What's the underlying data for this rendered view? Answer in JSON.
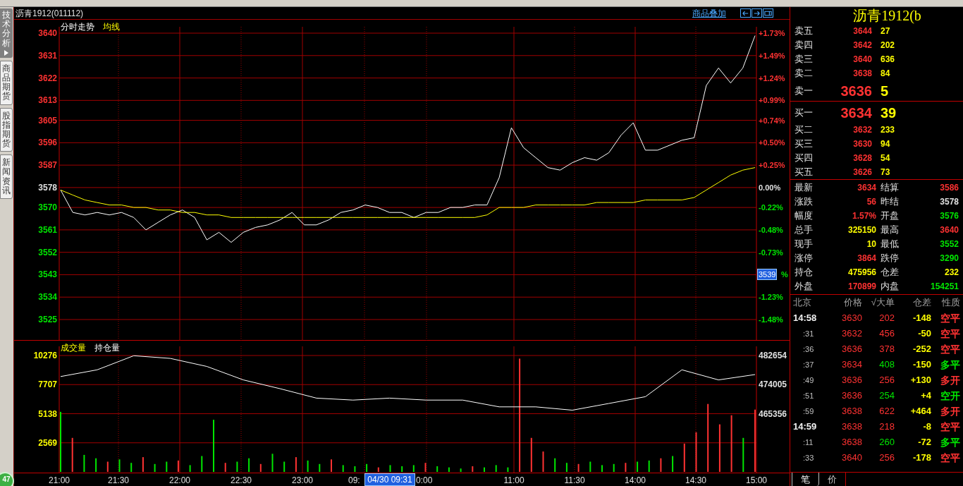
{
  "side_tabs": [
    {
      "label": "技术分析",
      "selected": true
    },
    {
      "label": "商品期货",
      "selected": false
    },
    {
      "label": "股指期货",
      "selected": false
    },
    {
      "label": "新闻资讯",
      "selected": false
    }
  ],
  "badge": "47",
  "chart_header": {
    "title": "沥青1912(011112)",
    "overlay_link": "商品叠加"
  },
  "price_pane": {
    "percent_labels": [
      {
        "text": "+1.73%",
        "color": "#ff3232"
      },
      {
        "text": "+1.49%",
        "color": "#ff3232"
      },
      {
        "text": "+1.24%",
        "color": "#ff3232"
      },
      {
        "text": "+0.99%",
        "color": "#ff3232"
      },
      {
        "text": "+0.74%",
        "color": "#ff3232"
      },
      {
        "text": "+0.50%",
        "color": "#ff3232"
      },
      {
        "text": "+0.25%",
        "color": "#ff3232"
      },
      {
        "text": "0.00%",
        "color": "#e0e0e0"
      },
      {
        "text": "-0.22%",
        "color": "#00e600"
      },
      {
        "text": "-0.48%",
        "color": "#00e600"
      },
      {
        "text": "-0.73%",
        "color": "#00e600"
      },
      {
        "text": "%",
        "color": "#00e600"
      },
      {
        "text": "-1.23%",
        "color": "#00e600"
      },
      {
        "text": "-1.48%",
        "color": "#00e600"
      }
    ],
    "chart_data": {
      "type": "line",
      "ylim": [
        3525,
        3640
      ],
      "grid": true,
      "yticks": [
        {
          "value": 3640,
          "label": "3640"
        },
        {
          "value": 3631,
          "label": "3631"
        },
        {
          "value": 3622,
          "label": "3622"
        },
        {
          "value": 3613,
          "label": "3613"
        },
        {
          "value": 3605,
          "label": "3605"
        },
        {
          "value": 3596,
          "label": "3596"
        },
        {
          "value": 3587,
          "label": "3587"
        },
        {
          "value": 3578,
          "label": "3578"
        },
        {
          "value": 3570,
          "label": "3570"
        },
        {
          "value": 3561,
          "label": "3561"
        },
        {
          "value": 3552,
          "label": "3552"
        },
        {
          "value": 3543,
          "label": "3543"
        },
        {
          "value": 3534,
          "label": "3534"
        },
        {
          "value": 3525,
          "label": "3525"
        }
      ],
      "series": [
        {
          "name": "分时走势",
          "color": "#ffffff",
          "values": [
            3577,
            3568,
            3567,
            3568,
            3567,
            3568,
            3566,
            3561,
            3564,
            3567,
            3569,
            3566,
            3557,
            3560,
            3556,
            3560,
            3562,
            3563,
            3565,
            3568,
            3563,
            3563,
            3565,
            3568,
            3569,
            3571,
            3570,
            3568,
            3568,
            3566,
            3568,
            3568,
            3570,
            3570,
            3571,
            3571,
            3582,
            3602,
            3594,
            3590,
            3586,
            3585,
            3588,
            3590,
            3589,
            3592,
            3599,
            3604,
            3593,
            3593,
            3595,
            3597,
            3598,
            3619,
            3626,
            3620,
            3626,
            3639
          ]
        },
        {
          "name": "均线",
          "color": "#ffff00",
          "values": [
            3577,
            3575,
            3573,
            3572,
            3571,
            3571,
            3570,
            3570,
            3569,
            3569,
            3568,
            3568,
            3567,
            3567,
            3566,
            3566,
            3566,
            3566,
            3566,
            3566,
            3566,
            3566,
            3566,
            3566,
            3566,
            3566,
            3566,
            3566,
            3566,
            3566,
            3566,
            3566,
            3566,
            3566,
            3566,
            3567,
            3570,
            3570,
            3570,
            3571,
            3571,
            3571,
            3571,
            3571,
            3572,
            3572,
            3572,
            3572,
            3573,
            3573,
            3573,
            3573,
            3574,
            3577,
            3580,
            3583,
            3585,
            3586
          ]
        }
      ]
    }
  },
  "volume_pane": {
    "volume": {
      "chart_data": {
        "type": "bar",
        "ylim": [
          0,
          10276
        ],
        "grid": true,
        "yticks": [
          {
            "value": 10276,
            "label": "10276"
          },
          {
            "value": 7707,
            "label": "7707"
          },
          {
            "value": 5138,
            "label": "5138"
          },
          {
            "value": 2569,
            "label": "2569"
          }
        ],
        "series": [
          {
            "name": "成交量",
            "color": "#ff3232",
            "values": [
              null,
              3000,
              null,
              null,
              900,
              null,
              null,
              1300,
              null,
              null,
              1000,
              null,
              null,
              null,
              800,
              null,
              null,
              700,
              null,
              null,
              1300,
              null,
              null,
              1100,
              null,
              null,
              null,
              400,
              null,
              null,
              null,
              800,
              null,
              null,
              null,
              500,
              null,
              null,
              null,
              10000,
              3000,
              1800,
              null,
              null,
              700,
              null,
              null,
              null,
              800,
              null,
              null,
              1200,
              null,
              2500,
              3500,
              6000,
              4200,
              5000,
              null,
              5500
            ]
          },
          {
            "color": "#00e600",
            "values": [
              5300,
              null,
              1500,
              1200,
              null,
              1100,
              800,
              null,
              700,
              900,
              null,
              600,
              1400,
              4600,
              null,
              900,
              1200,
              null,
              1600,
              900,
              null,
              1000,
              700,
              null,
              600,
              500,
              700,
              null,
              600,
              500,
              600,
              null,
              500,
              400,
              300,
              null,
              400,
              600,
              400,
              null,
              null,
              null,
              1200,
              800,
              null,
              900,
              600,
              700,
              null,
              900,
              1000,
              null,
              1400,
              null,
              null,
              null,
              null,
              null,
              3000,
              null
            ]
          }
        ]
      }
    },
    "open_interest": {
      "chart_data": {
        "type": "line",
        "ylim": [
          465356,
          482654
        ],
        "yticks": [
          {
            "value": 482654,
            "label": "482654"
          },
          {
            "value": 474005,
            "label": "474005"
          },
          {
            "value": 465356,
            "label": "465356"
          }
        ],
        "series": [
          {
            "name": "持仓量",
            "color": "#ffffff",
            "values": [
              476400,
              478400,
              482600,
              481800,
              479400,
              475400,
              472800,
              470000,
              469400,
              470000,
              469400,
              469400,
              467400,
              467400,
              466400,
              468400,
              470400,
              478400,
              475400,
              477000
            ]
          }
        ]
      }
    }
  },
  "time_axis": {
    "labels": [
      "21:00",
      "21:30",
      "22:00",
      "22:30",
      "23:00",
      "09:",
      "0:00",
      "11:00",
      "11:30",
      "14:00",
      "14:30",
      "15:00"
    ]
  },
  "crosshair": {
    "price_label": "3539",
    "time_label": "04/30 09:31"
  },
  "quote": {
    "title": "沥青1912(b",
    "asks": [
      {
        "label": "卖五",
        "price": "3644",
        "volume": "27",
        "kind": "level"
      },
      {
        "label": "卖四",
        "price": "3642",
        "volume": "202",
        "kind": "level"
      },
      {
        "label": "卖三",
        "price": "3640",
        "volume": "636",
        "kind": "level"
      },
      {
        "label": "卖二",
        "price": "3638",
        "volume": "84",
        "kind": "level"
      },
      {
        "label": "卖一",
        "price": "3636",
        "volume": "5",
        "kind": "best"
      }
    ],
    "bids": [
      {
        "label": "买一",
        "price": "3634",
        "volume": "39",
        "kind": "best"
      },
      {
        "label": "买二",
        "price": "3632",
        "volume": "233",
        "kind": "level"
      },
      {
        "label": "买三",
        "price": "3630",
        "volume": "94",
        "kind": "level"
      },
      {
        "label": "买四",
        "price": "3628",
        "volume": "54",
        "kind": "level"
      },
      {
        "label": "买五",
        "price": "3626",
        "volume": "73",
        "kind": "level"
      }
    ],
    "stats": [
      {
        "label": "最新",
        "value": "3634",
        "color": "#ff3232"
      },
      {
        "label": "结算",
        "value": "3586",
        "color": "#ff3232"
      },
      {
        "label": "涨跌",
        "value": "56",
        "color": "#ff3232"
      },
      {
        "label": "昨结",
        "value": "3578",
        "color": "#e0e0e0"
      },
      {
        "label": "幅度",
        "value": "1.57%",
        "color": "#ff3232"
      },
      {
        "label": "开盘",
        "value": "3576",
        "color": "#00e600"
      },
      {
        "label": "总手",
        "value": "325150",
        "color": "#ffff00"
      },
      {
        "label": "最高",
        "value": "3640",
        "color": "#ff3232"
      },
      {
        "label": "现手",
        "value": "10",
        "color": "#ffff00"
      },
      {
        "label": "最低",
        "value": "3552",
        "color": "#00e600"
      },
      {
        "label": "涨停",
        "value": "3864",
        "color": "#ff3232"
      },
      {
        "label": "跌停",
        "value": "3290",
        "color": "#00e600"
      },
      {
        "label": "持仓",
        "value": "475956",
        "color": "#ffff00"
      },
      {
        "label": "仓差",
        "value": "232",
        "color": "#ffff00"
      },
      {
        "label": "外盘",
        "value": "170899",
        "color": "#ff3232"
      },
      {
        "label": "内盘",
        "value": "154251",
        "color": "#00e600"
      }
    ],
    "ticks_columns": [
      "北京",
      "价格",
      "√大单",
      "仓差",
      "性质"
    ],
    "ticks": [
      {
        "time": "14:58",
        "kind": "full",
        "price": "3630",
        "volume": {
          "text": "202",
          "color": "#ff3232"
        },
        "diff": "-148",
        "nature": {
          "text": "空平",
          "color": "#ff3232"
        }
      },
      {
        "time": ":31",
        "kind": "short",
        "price": "3632",
        "volume": {
          "text": "456",
          "color": "#ff3232"
        },
        "diff": "-50",
        "nature": {
          "text": "空平",
          "color": "#ff3232"
        }
      },
      {
        "time": ":36",
        "kind": "short",
        "price": "3636",
        "volume": {
          "text": "378",
          "color": "#ff3232"
        },
        "diff": "-252",
        "nature": {
          "text": "空平",
          "color": "#ff3232"
        }
      },
      {
        "time": ":37",
        "kind": "short",
        "price": "3634",
        "volume": {
          "text": "408",
          "color": "#00e600"
        },
        "diff": "-150",
        "nature": {
          "text": "多平",
          "color": "#00e600"
        }
      },
      {
        "time": ":49",
        "kind": "short",
        "price": "3636",
        "volume": {
          "text": "256",
          "color": "#ff3232"
        },
        "diff": "+130",
        "nature": {
          "text": "多开",
          "color": "#ff3232"
        }
      },
      {
        "time": ":51",
        "kind": "short",
        "price": "3636",
        "volume": {
          "text": "254",
          "color": "#00e600"
        },
        "diff": "+4",
        "nature": {
          "text": "空开",
          "color": "#00e600"
        }
      },
      {
        "time": ":59",
        "kind": "short",
        "price": "3638",
        "volume": {
          "text": "622",
          "color": "#ff3232"
        },
        "diff": "+464",
        "nature": {
          "text": "多开",
          "color": "#ff3232"
        }
      },
      {
        "time": "14:59",
        "kind": "full",
        "price": "3638",
        "volume": {
          "text": "218",
          "color": "#ff3232"
        },
        "diff": "-8",
        "nature": {
          "text": "空平",
          "color": "#ff3232"
        }
      },
      {
        "time": ":11",
        "kind": "short",
        "price": "3638",
        "volume": {
          "text": "260",
          "color": "#00e600"
        },
        "diff": "-72",
        "nature": {
          "text": "多平",
          "color": "#00e600"
        }
      },
      {
        "time": ":33",
        "kind": "short",
        "price": "3640",
        "volume": {
          "text": "256",
          "color": "#ff3232"
        },
        "diff": "-178",
        "nature": {
          "text": "空平",
          "color": "#ff3232"
        }
      }
    ],
    "bottom_tabs": [
      {
        "label": "笔",
        "selected": true
      },
      {
        "label": "价",
        "selected": false
      }
    ]
  }
}
